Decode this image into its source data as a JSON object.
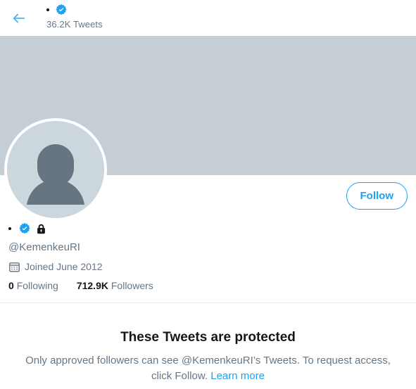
{
  "header": {
    "back_icon": "back-arrow-icon",
    "display_name": "",
    "verified_icon": "verified-badge-icon",
    "tweet_count": "36.2K Tweets"
  },
  "banner": {
    "color": "#c5ced5",
    "alt": "profile-banner-placeholder"
  },
  "avatar": {
    "icon": "default-avatar-person-icon",
    "background_color": "#ccd6dd",
    "silhouette_color": "#66757f"
  },
  "actions": {
    "follow_label": "Follow",
    "follow_color": "#1da1f2"
  },
  "profile": {
    "display_name": "",
    "verified_icon": "verified-badge-icon",
    "protected_icon": "lock-icon",
    "handle": "@KemenkeuRI",
    "joined_icon": "calendar-icon",
    "joined": "Joined June 2012",
    "following_count": "0",
    "following_label": "Following",
    "followers_count": "712.9K",
    "followers_label": "Followers"
  },
  "protected_notice": {
    "title": "These Tweets are protected",
    "body": "Only approved followers can see @KemenkeuRI’s Tweets. To request access, click Follow. ",
    "link_label": "Learn more"
  }
}
